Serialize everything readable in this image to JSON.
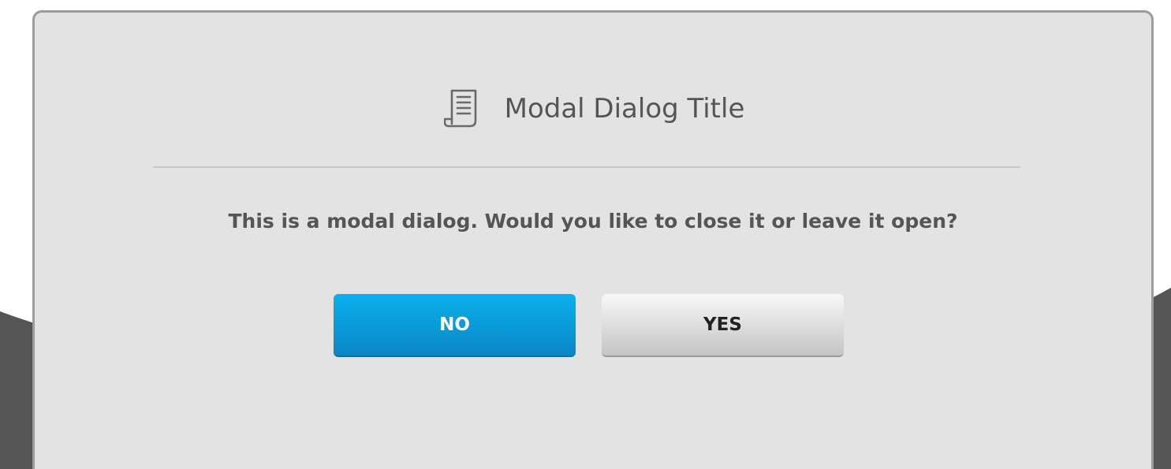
{
  "modal": {
    "title": "Modal Dialog Title",
    "title_icon": "document-icon",
    "message": "This is a modal dialog. Would you like to close it or leave it open?",
    "buttons": {
      "no_label": "NO",
      "yes_label": "YES"
    }
  },
  "colors": {
    "primary_button": "#0a9ad8",
    "modal_background": "#e3e3e3",
    "backdrop_dark": "#555555",
    "text": "#555555"
  }
}
